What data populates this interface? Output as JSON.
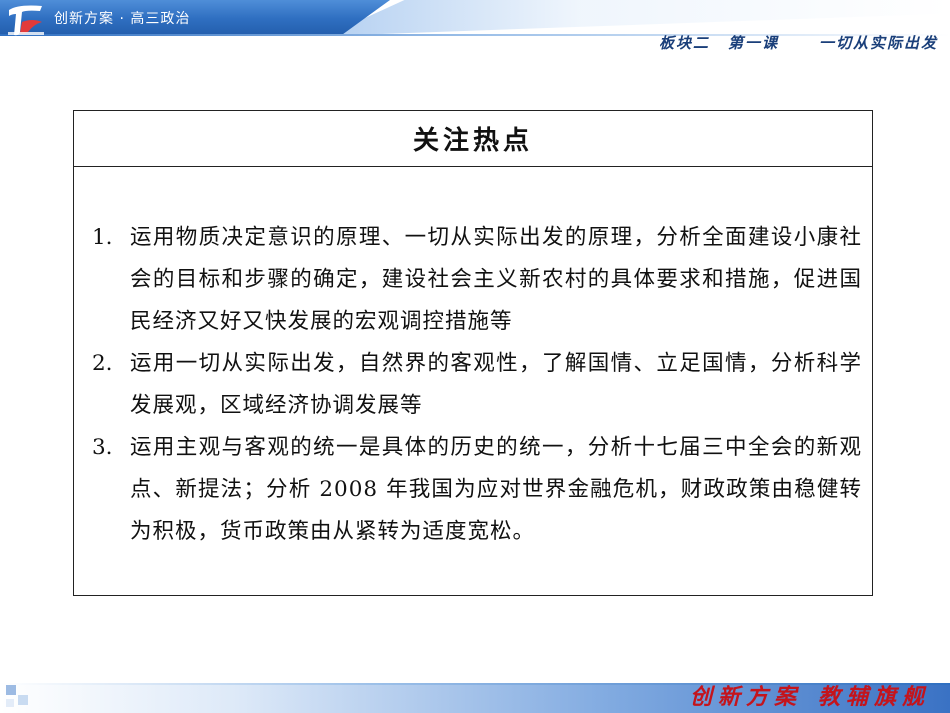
{
  "header": {
    "title": "创新方案 · 高三政治",
    "breadcrumb": {
      "part": "板块二",
      "lesson": "第一课",
      "topic": "一切从实际出发"
    }
  },
  "content": {
    "title": "关注热点",
    "items": [
      {
        "number": "1.",
        "text": "运用物质决定意识的原理、一切从实际出发的原理，分析全面建设小康社会的目标和步骤的确定，建设社会主义新农村的具体要求和措施，促进国民经济又好又快发展的宏观调控措施等"
      },
      {
        "number": "2.",
        "text": "运用一切从实际出发，自然界的客观性，了解国情、立足国情，分析科学发展观，区域经济协调发展等"
      },
      {
        "number": "3.",
        "text": "运用主观与客观的统一是具体的历史的统一，分析十七届三中全会的新观点、新提法；分析 2008 年我国为应对世界金融危机，财政政策由稳健转为积极，货币政策由从紧转为适度宽松。"
      }
    ]
  },
  "footer": {
    "brand_left": "创新方案",
    "brand_right": "教辅旗舰"
  },
  "colors": {
    "header_blue": "#2f6fc1",
    "breadcrumb": "#1a3f7a",
    "footer_red": "#c4141c"
  }
}
